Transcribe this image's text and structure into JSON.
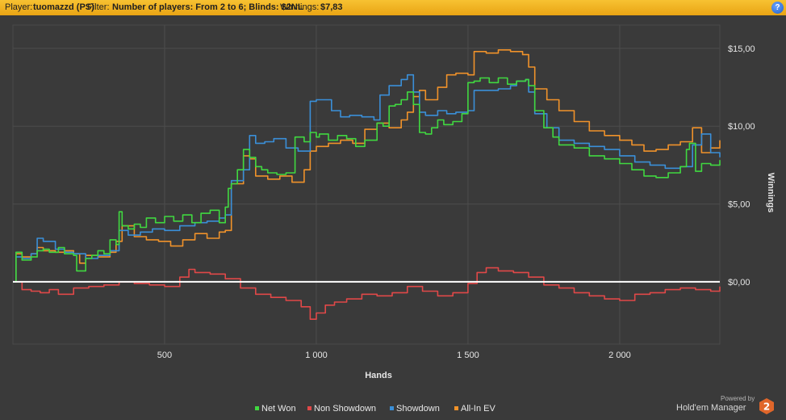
{
  "header": {
    "player_label": "Player:",
    "player_value": "tuomazzd (PS)",
    "filter_label": "Filter:",
    "filter_value": "Number of players: From 2 to 6; Blinds: $2NL",
    "winnings_label": "Winnings:",
    "winnings_value": "$7,83",
    "help_glyph": "?",
    "help_icon": "help-icon"
  },
  "branding": {
    "powered_by": "Powered by",
    "product": "Hold'em Manager",
    "badge": "2"
  },
  "colors": {
    "background": "#3a3a3a",
    "header_bar": "#f0b223",
    "grid": "#4d4d4d",
    "net_won": "#40d840",
    "non_showdown": "#e04848",
    "showdown": "#3a8fd8",
    "all_in_ev": "#f0922a",
    "zero_line": "#ffffff"
  },
  "chart_data": {
    "type": "line",
    "title": "",
    "xlabel": "Hands",
    "ylabel": "Winnings",
    "xlim": [
      0,
      2330
    ],
    "ylim": [
      -4,
      16.5
    ],
    "xticks": [
      500,
      1000,
      1500,
      2000
    ],
    "xtick_labels": [
      "500",
      "1 000",
      "1 500",
      "2 000"
    ],
    "yticks": [
      0,
      5,
      10,
      15
    ],
    "ytick_labels": [
      "$0,00",
      "$5,00",
      "$10,00",
      "$15,00"
    ],
    "grid": true,
    "legend_position": "bottom",
    "series": [
      {
        "name": "Net Won",
        "color": "#40d840",
        "x": [
          0,
          10,
          30,
          60,
          80,
          100,
          120,
          150,
          170,
          200,
          210,
          240,
          260,
          280,
          300,
          320,
          340,
          350,
          360,
          380,
          400,
          420,
          440,
          470,
          500,
          530,
          560,
          590,
          620,
          650,
          680,
          700,
          710,
          720,
          740,
          760,
          780,
          800,
          820,
          840,
          870,
          900,
          930,
          960,
          980,
          1000,
          1010,
          1040,
          1070,
          1100,
          1130,
          1160,
          1200,
          1220,
          1240,
          1260,
          1280,
          1300,
          1320,
          1340,
          1360,
          1380,
          1400,
          1420,
          1450,
          1480,
          1500,
          1520,
          1540,
          1570,
          1600,
          1630,
          1660,
          1690,
          1700,
          1720,
          1750,
          1780,
          1800,
          1850,
          1900,
          1950,
          2000,
          2040,
          2080,
          2120,
          2160,
          2200,
          2220,
          2230,
          2250,
          2270,
          2300,
          2330
        ],
        "y": [
          0,
          1.9,
          1.4,
          1.6,
          2.0,
          2.1,
          1.9,
          2.2,
          1.8,
          1.7,
          0.7,
          1.5,
          1.7,
          2.0,
          1.8,
          2.7,
          2.4,
          4.5,
          3.6,
          3.4,
          3.7,
          3.5,
          4.1,
          3.8,
          4.2,
          3.9,
          4.3,
          3.8,
          4.4,
          4.6,
          3.8,
          4.8,
          6.0,
          6.3,
          7.2,
          8.5,
          8.0,
          7.4,
          7.2,
          7.0,
          6.9,
          7.0,
          9.3,
          9.0,
          9.6,
          9.3,
          9.5,
          9.1,
          9.4,
          9.2,
          8.7,
          9.1,
          10.2,
          10.0,
          11.3,
          11.4,
          11.7,
          12.2,
          11.4,
          9.6,
          9.5,
          9.9,
          10.4,
          10.1,
          10.3,
          10.8,
          12.8,
          12.9,
          13.1,
          12.8,
          13.1,
          12.7,
          12.9,
          13.0,
          12.6,
          11.0,
          9.9,
          9.3,
          8.8,
          8.6,
          8.1,
          7.9,
          7.6,
          7.2,
          6.8,
          6.7,
          7.0,
          7.4,
          8.5,
          8.9,
          7.1,
          7.6,
          7.5,
          7.83
        ]
      },
      {
        "name": "Non Showdown",
        "color": "#e04848",
        "x": [
          0,
          30,
          60,
          90,
          120,
          150,
          200,
          250,
          300,
          350,
          400,
          450,
          500,
          550,
          580,
          600,
          650,
          700,
          750,
          800,
          850,
          900,
          950,
          980,
          1000,
          1030,
          1060,
          1100,
          1150,
          1200,
          1250,
          1300,
          1350,
          1400,
          1450,
          1500,
          1530,
          1560,
          1600,
          1650,
          1700,
          1750,
          1800,
          1850,
          1900,
          1950,
          2000,
          2050,
          2100,
          2150,
          2200,
          2250,
          2300,
          2330
        ],
        "y": [
          0,
          -0.5,
          -0.6,
          -0.7,
          -0.5,
          -0.8,
          -0.4,
          -0.3,
          -0.2,
          0,
          -0.1,
          -0.2,
          -0.3,
          0.3,
          0.8,
          0.6,
          0.5,
          0.2,
          -0.4,
          -0.8,
          -1.0,
          -1.2,
          -1.6,
          -2.4,
          -2.0,
          -1.5,
          -1.3,
          -1.1,
          -0.8,
          -0.9,
          -0.7,
          -0.3,
          -0.6,
          -0.9,
          -0.7,
          -0.1,
          0.6,
          0.9,
          0.7,
          0.6,
          0.3,
          -0.2,
          -0.4,
          -0.7,
          -0.9,
          -1.1,
          -1.2,
          -0.8,
          -0.7,
          -0.5,
          -0.4,
          -0.5,
          -0.6,
          -0.3
        ]
      },
      {
        "name": "Showdown",
        "color": "#3a8fd8",
        "x": [
          0,
          10,
          30,
          60,
          80,
          100,
          140,
          170,
          200,
          240,
          280,
          320,
          350,
          380,
          420,
          460,
          500,
          550,
          600,
          640,
          680,
          700,
          720,
          760,
          780,
          800,
          830,
          860,
          900,
          940,
          980,
          1000,
          1050,
          1080,
          1110,
          1150,
          1190,
          1210,
          1240,
          1280,
          1300,
          1320,
          1340,
          1360,
          1400,
          1430,
          1460,
          1500,
          1520,
          1560,
          1600,
          1640,
          1660,
          1690,
          1700,
          1720,
          1760,
          1800,
          1850,
          1900,
          1950,
          2000,
          2050,
          2100,
          2150,
          2200,
          2240,
          2270,
          2300,
          2330
        ],
        "y": [
          0,
          1.6,
          1.5,
          1.8,
          2.8,
          2.6,
          2.1,
          1.9,
          1.8,
          1.5,
          1.7,
          2.0,
          3.3,
          3.0,
          3.2,
          3.4,
          3.3,
          3.6,
          3.8,
          3.9,
          4.1,
          4.3,
          6.5,
          7.2,
          9.4,
          8.9,
          9.0,
          9.2,
          8.6,
          8.4,
          11.6,
          11.7,
          11.0,
          10.6,
          10.7,
          10.6,
          10.4,
          12.0,
          12.6,
          13.0,
          13.3,
          12.2,
          10.9,
          10.7,
          11.0,
          10.8,
          10.9,
          11.0,
          12.3,
          12.3,
          12.4,
          12.6,
          12.9,
          13.0,
          12.2,
          10.8,
          9.9,
          9.1,
          8.9,
          8.7,
          8.5,
          8.1,
          7.7,
          7.5,
          7.3,
          7.4,
          8.8,
          9.5,
          8.3,
          8.0
        ]
      },
      {
        "name": "All-In EV",
        "color": "#f0922a",
        "x": [
          0,
          10,
          30,
          60,
          80,
          100,
          140,
          170,
          200,
          220,
          240,
          280,
          320,
          340,
          360,
          400,
          440,
          480,
          520,
          560,
          600,
          640,
          680,
          700,
          720,
          760,
          780,
          800,
          840,
          880,
          920,
          960,
          980,
          1000,
          1040,
          1080,
          1120,
          1160,
          1200,
          1240,
          1280,
          1300,
          1320,
          1340,
          1360,
          1400,
          1430,
          1460,
          1500,
          1520,
          1560,
          1600,
          1640,
          1680,
          1700,
          1720,
          1760,
          1800,
          1850,
          1900,
          1950,
          2000,
          2040,
          2080,
          2120,
          2160,
          2200,
          2240,
          2270,
          2300,
          2330
        ],
        "y": [
          0,
          1.8,
          1.6,
          1.8,
          2.2,
          2.0,
          1.9,
          2.0,
          1.8,
          1.2,
          1.7,
          1.6,
          1.9,
          2.6,
          3.6,
          2.9,
          2.7,
          2.6,
          2.3,
          2.7,
          3.1,
          2.8,
          3.2,
          3.3,
          6.3,
          8.1,
          7.9,
          6.8,
          6.6,
          6.8,
          6.4,
          7.2,
          8.4,
          8.7,
          8.9,
          9.1,
          8.9,
          9.8,
          10.2,
          9.9,
          10.4,
          10.9,
          11.9,
          12.3,
          11.7,
          12.5,
          13.3,
          13.4,
          13.3,
          14.8,
          14.7,
          14.9,
          14.8,
          14.6,
          13.8,
          12.4,
          11.7,
          11.0,
          10.3,
          9.7,
          9.4,
          9.1,
          8.8,
          8.4,
          8.5,
          8.8,
          9.0,
          9.9,
          8.3,
          8.6,
          9.1
        ]
      }
    ],
    "zero_line": 0
  }
}
